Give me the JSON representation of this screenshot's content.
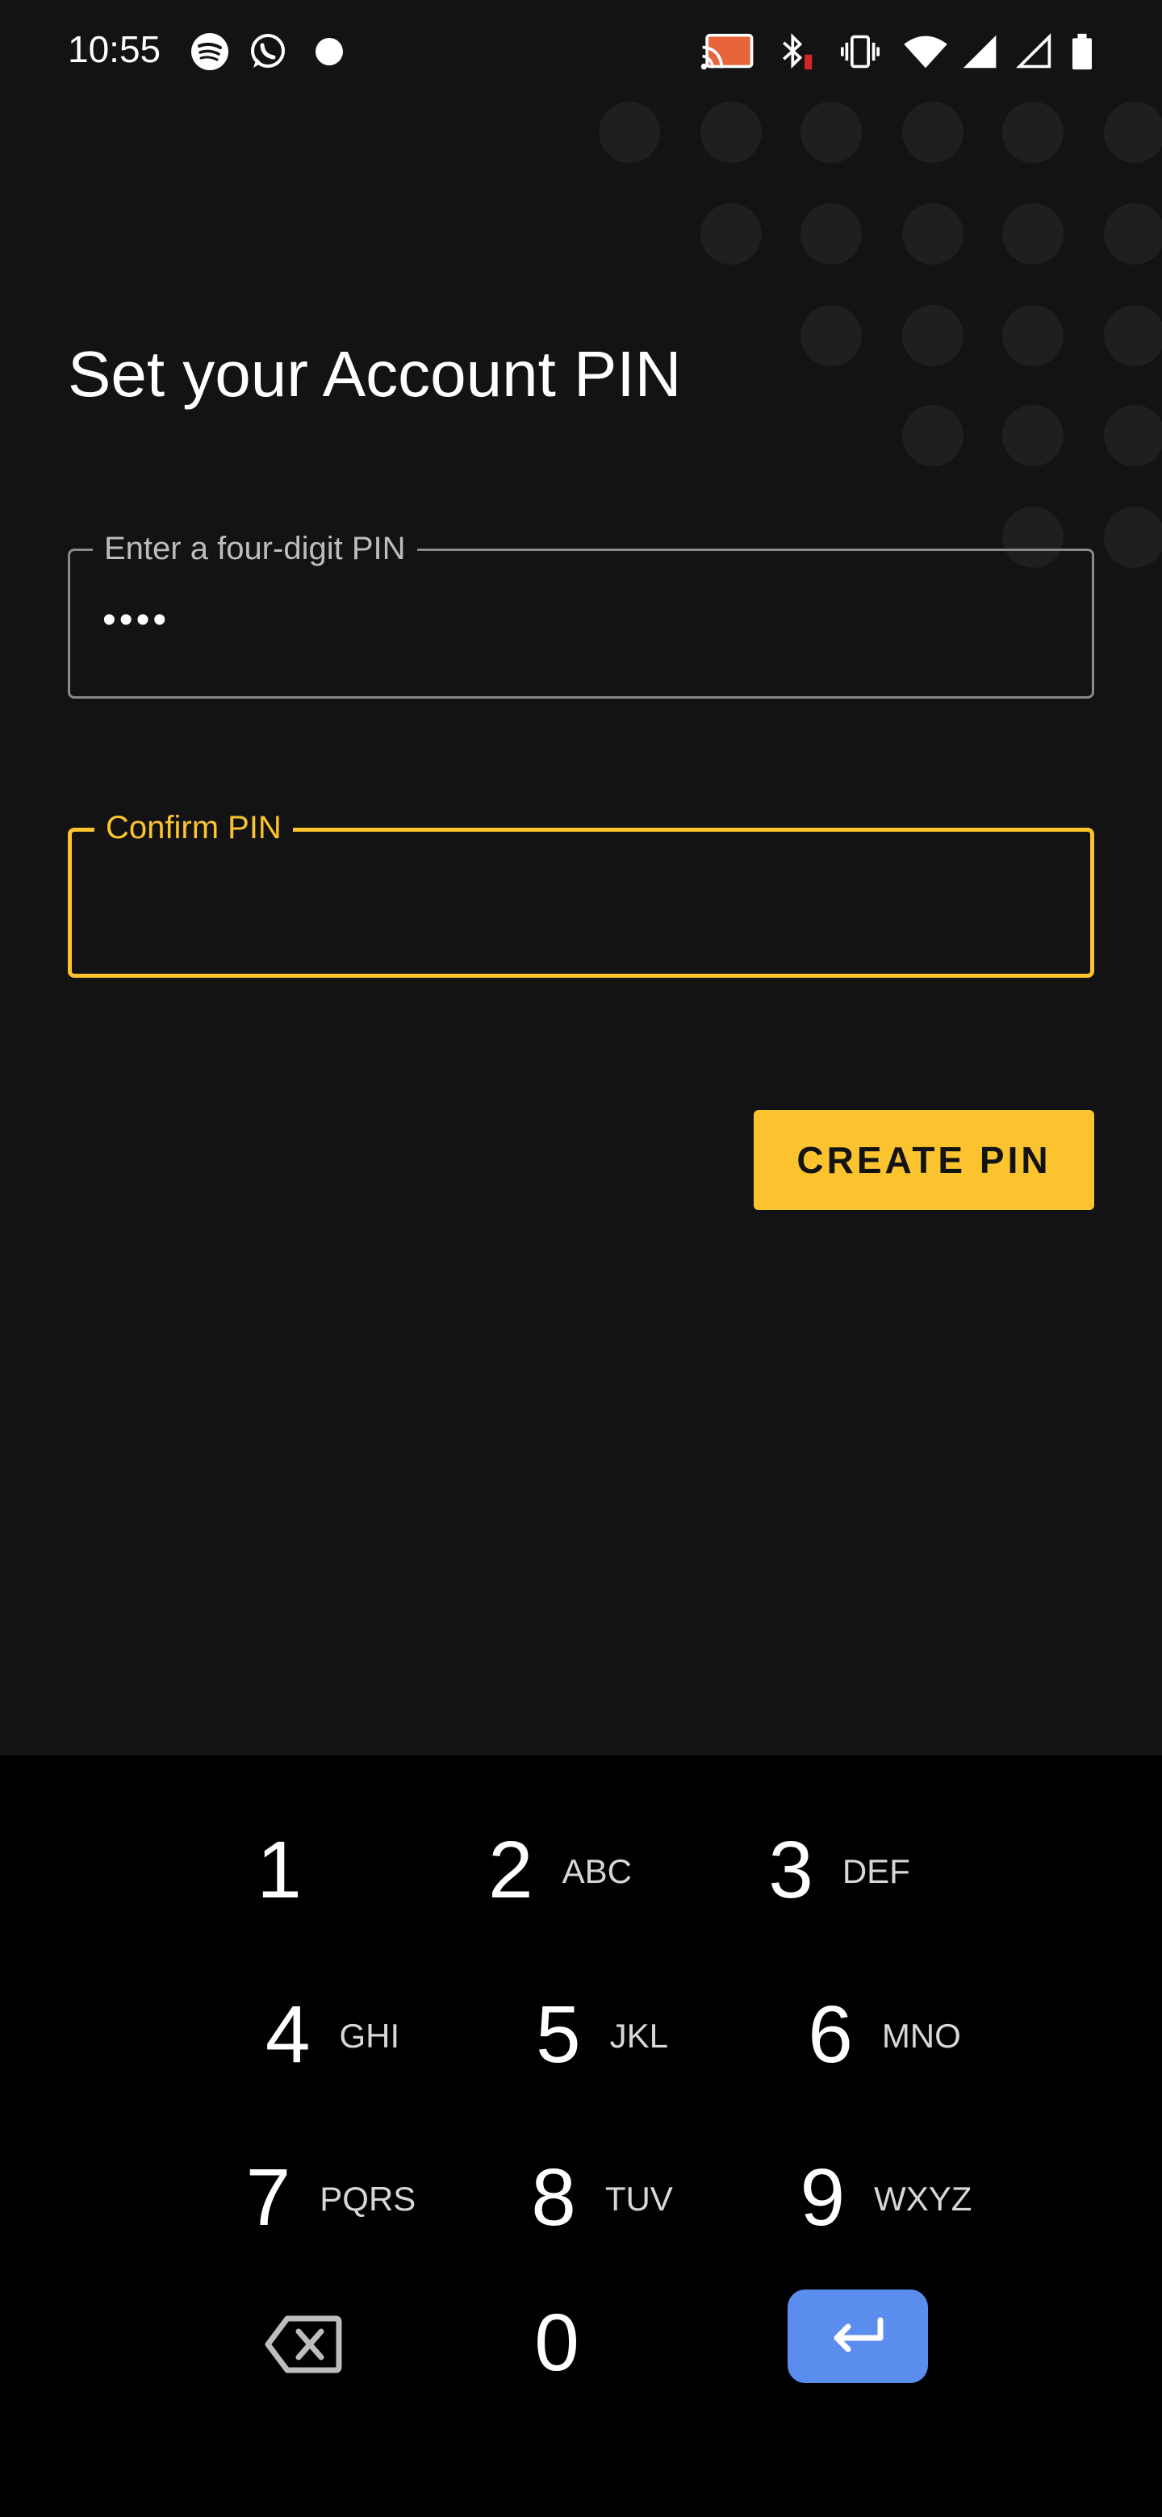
{
  "status_bar": {
    "time": "10:55",
    "left_icons": [
      "spotify-icon",
      "whatsapp-icon",
      "dot-icon"
    ],
    "right_icons": [
      "cast-icon",
      "bluetooth-icon",
      "vibrate-icon",
      "wifi-icon",
      "signal-icon",
      "signal-empty-icon",
      "battery-icon"
    ]
  },
  "page": {
    "title": "Set your Account PIN"
  },
  "pin_field": {
    "label": "Enter a four-digit PIN",
    "value": "••••"
  },
  "confirm_field": {
    "label": "Confirm PIN",
    "value": ""
  },
  "create_button": {
    "label": "CREATE PIN"
  },
  "keypad": {
    "keys": [
      {
        "num": "1",
        "letters": ""
      },
      {
        "num": "2",
        "letters": "ABC"
      },
      {
        "num": "3",
        "letters": "DEF"
      },
      {
        "num": "4",
        "letters": "GHI"
      },
      {
        "num": "5",
        "letters": "JKL"
      },
      {
        "num": "6",
        "letters": "MNO"
      },
      {
        "num": "7",
        "letters": "PQRS"
      },
      {
        "num": "8",
        "letters": "TUV"
      },
      {
        "num": "9",
        "letters": "WXYZ"
      },
      {
        "num": "0",
        "letters": ""
      }
    ],
    "backspace_icon": "backspace-icon",
    "enter_icon": "enter-icon"
  },
  "colors": {
    "background": "#131314",
    "accent": "#fbc32d",
    "keypad_background": "#000000",
    "enter_key": "#5b8def"
  }
}
